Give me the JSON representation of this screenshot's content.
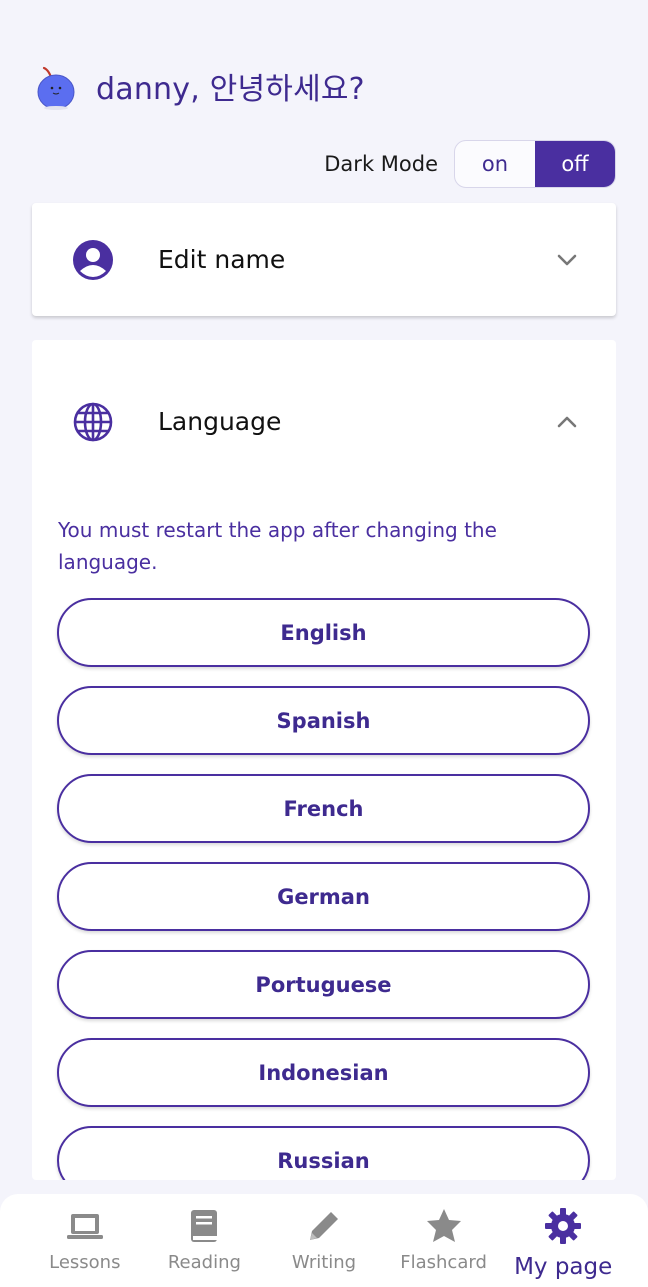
{
  "header": {
    "greeting": "danny, 안녕하세요?",
    "dark_mode_label": "Dark Mode",
    "dark_mode_options": [
      "on",
      "off"
    ],
    "dark_mode_selected": "off"
  },
  "edit_name": {
    "title": "Edit name"
  },
  "language": {
    "title": "Language",
    "notice": "You must restart the app after changing the language.",
    "options": [
      "English",
      "Spanish",
      "French",
      "German",
      "Portuguese",
      "Indonesian",
      "Russian"
    ]
  },
  "nav": {
    "items": [
      {
        "label": "Lessons",
        "icon": "laptop-icon"
      },
      {
        "label": "Reading",
        "icon": "book-icon"
      },
      {
        "label": "Writing",
        "icon": "pencil-icon"
      },
      {
        "label": "Flashcard",
        "icon": "star-icon"
      },
      {
        "label": "My page",
        "icon": "gear-icon"
      }
    ],
    "active": "My page"
  },
  "colors": {
    "accent": "#4a2fa0",
    "accent_text": "#3e2a8f",
    "inactive_nav": "#8a8a8a",
    "background": "#f4f4fb"
  }
}
